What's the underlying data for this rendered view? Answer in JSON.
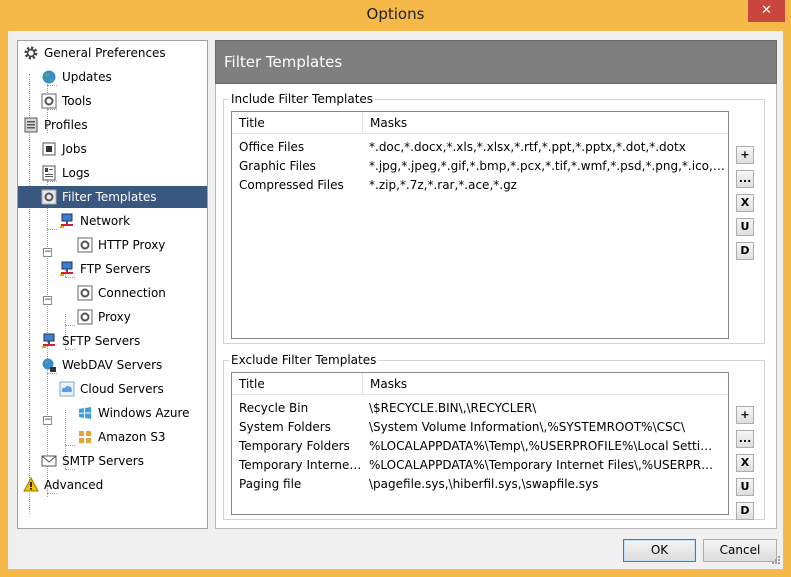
{
  "window": {
    "title": "Options",
    "close_glyph": "✕"
  },
  "tree": {
    "items": [
      {
        "label": "General Preferences",
        "icon": "gear-icon"
      },
      {
        "label": "Updates",
        "icon": "globe-icon"
      },
      {
        "label": "Tools",
        "icon": "tools-icon"
      },
      {
        "label": "Profiles",
        "icon": "profiles-icon"
      },
      {
        "label": "Jobs",
        "icon": "jobs-icon"
      },
      {
        "label": "Logs",
        "icon": "logs-icon"
      },
      {
        "label": "Filter Templates",
        "icon": "filter-icon"
      },
      {
        "label": "Network",
        "icon": "network-icon"
      },
      {
        "label": "HTTP Proxy",
        "icon": "http-proxy-icon"
      },
      {
        "label": "FTP Servers",
        "icon": "ftp-servers-icon"
      },
      {
        "label": "Connection",
        "icon": "connection-icon"
      },
      {
        "label": "Proxy",
        "icon": "proxy-icon"
      },
      {
        "label": "SFTP Servers",
        "icon": "sftp-servers-icon"
      },
      {
        "label": "WebDAV Servers",
        "icon": "webdav-icon"
      },
      {
        "label": "Cloud Servers",
        "icon": "cloud-icon"
      },
      {
        "label": "Windows Azure",
        "icon": "windows-logo-icon"
      },
      {
        "label": "Amazon S3",
        "icon": "amazon-s3-icon"
      },
      {
        "label": "SMTP Servers",
        "icon": "envelope-icon"
      },
      {
        "label": "Advanced",
        "icon": "warning-icon"
      }
    ],
    "selected": "Filter Templates"
  },
  "panel": {
    "title": "Filter Templates"
  },
  "include": {
    "label": "Include Filter Templates",
    "columns": [
      "Title",
      "Masks"
    ],
    "rows": [
      {
        "title": "Office Files",
        "masks": "*.doc,*.docx,*.xls,*.xlsx,*.rtf,*.ppt,*.pptx,*.dot,*.dotx"
      },
      {
        "title": "Graphic Files",
        "masks": "*.jpg,*.jpeg,*.gif,*.bmp,*.pcx,*.tif,*.wmf,*.psd,*.png,*.ico,*.cur"
      },
      {
        "title": "Compressed Files",
        "masks": "*.zip,*.7z,*.rar,*.ace,*.gz"
      }
    ]
  },
  "exclude": {
    "label": "Exclude Filter Templates",
    "columns": [
      "Title",
      "Masks"
    ],
    "rows": [
      {
        "title": "Recycle Bin",
        "masks": "\\$RECYCLE.BIN\\,\\RECYCLER\\"
      },
      {
        "title": "System Folders",
        "masks": "\\System Volume Information\\,%SYSTEMROOT%\\CSC\\"
      },
      {
        "title": "Temporary Folders",
        "masks": "%LOCALAPPDATA%\\Temp\\,%USERPROFILE%\\Local Settings\\Te..."
      },
      {
        "title": "Temporary Internet F...",
        "masks": "%LOCALAPPDATA%\\Temporary Internet Files\\,%USERPROFILE%..."
      },
      {
        "title": "Paging file",
        "masks": "\\pagefile.sys,\\hiberfil.sys,\\swapfile.sys"
      }
    ]
  },
  "side_buttons": {
    "add": "+",
    "edit": "...",
    "delete": "X",
    "up": "U",
    "down": "D"
  },
  "buttons": {
    "ok": "OK",
    "cancel": "Cancel"
  },
  "colors": {
    "titlebar": "#f5b94a",
    "selection": "#39577f",
    "header": "#7f7f7f",
    "close": "#c9463d"
  }
}
